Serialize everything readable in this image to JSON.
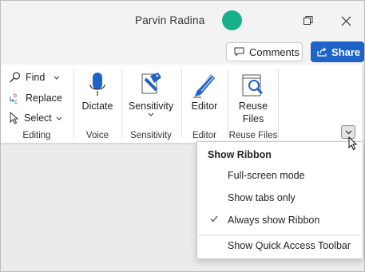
{
  "titlebar": {
    "user_name": "Parvin Radina",
    "avatar_color": "#16b08a"
  },
  "topbar": {
    "comments_label": "Comments",
    "share_label": "Share",
    "share_color": "#1d63c8"
  },
  "ribbon": {
    "editing": {
      "label": "Editing",
      "find": "Find",
      "replace": "Replace",
      "select": "Select"
    },
    "voice": {
      "label": "Voice",
      "dictate": "Dictate"
    },
    "sensitivity": {
      "label": "Sensitivity",
      "button": "Sensitivity"
    },
    "editor": {
      "label": "Editor",
      "button": "Editor"
    },
    "reuse_files": {
      "label": "Reuse Files",
      "button_line1": "Reuse",
      "button_line2": "Files"
    }
  },
  "ribbon_menu": {
    "title": "Show Ribbon",
    "items": [
      {
        "label": "Full-screen mode",
        "checked": false
      },
      {
        "label": "Show tabs only",
        "checked": false
      },
      {
        "label": "Always show Ribbon",
        "checked": true
      },
      {
        "label": "Show Quick Access Toolbar",
        "checked": false
      }
    ]
  }
}
